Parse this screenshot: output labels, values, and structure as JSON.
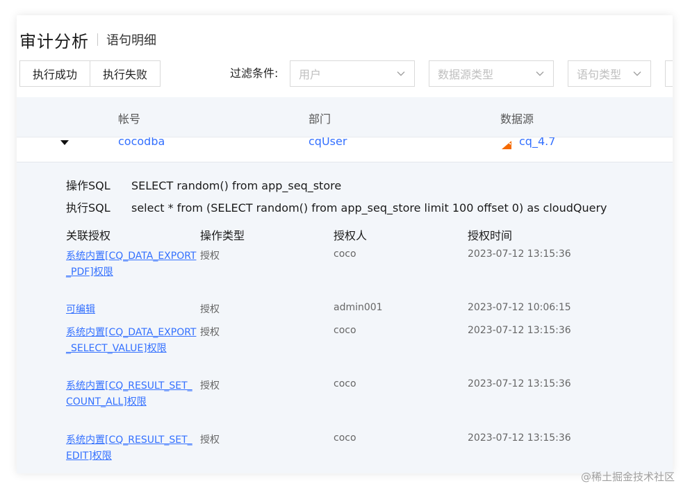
{
  "header": {
    "title": "审计分析",
    "subtitle": "语句明细"
  },
  "toolbar": {
    "success_label": "执行成功",
    "failure_label": "执行失败",
    "filter_label": "过滤条件:",
    "filters": [
      {
        "placeholder": "用户"
      },
      {
        "placeholder": "数据源类型"
      },
      {
        "placeholder": "语句类型"
      }
    ]
  },
  "table": {
    "columns": [
      "帐号",
      "部门",
      "数据源"
    ],
    "row": {
      "account": "cocodba",
      "department": "cqUser",
      "datasource": "cq_4.7"
    }
  },
  "detail": {
    "op_sql_label": "操作SQL",
    "op_sql": "SELECT random() from app_seq_store",
    "exec_sql_label": "执行SQL",
    "exec_sql": "select * from (SELECT random() from app_seq_store limit 100 offset 0) as cloudQuery",
    "columns": [
      "关联授权",
      "操作类型",
      "授权人",
      "授权时间"
    ],
    "rows": [
      {
        "permission": "系统内置[CQ_DATA_EXPORT_PDF]权限",
        "op_type": "授权",
        "grantor": "coco",
        "time": "2023-07-12 13:15:36"
      },
      {
        "permission": "可编辑",
        "op_type": "授权",
        "grantor": "admin001",
        "time": "2023-07-12 10:06:15"
      },
      {
        "permission": "系统内置[CQ_DATA_EXPORT_SELECT_VALUE]权限",
        "op_type": "授权",
        "grantor": "coco",
        "time": "2023-07-12 13:15:36"
      },
      {
        "permission": "系统内置[CQ_RESULT_SET_COUNT_ALL]权限",
        "op_type": "授权",
        "grantor": "coco",
        "time": "2023-07-12 13:15:36"
      },
      {
        "permission": "系统内置[CQ_RESULT_SET_EDIT]权限",
        "op_type": "授权",
        "grantor": "coco",
        "time": "2023-07-12 13:15:36"
      }
    ]
  },
  "watermark": "@稀土掘金技术社区",
  "colors": {
    "link": "#3370ff",
    "header_bg": "#f3f6fa",
    "detail_bg": "#f3f6fa",
    "datasource_icon": "#f56a00"
  }
}
